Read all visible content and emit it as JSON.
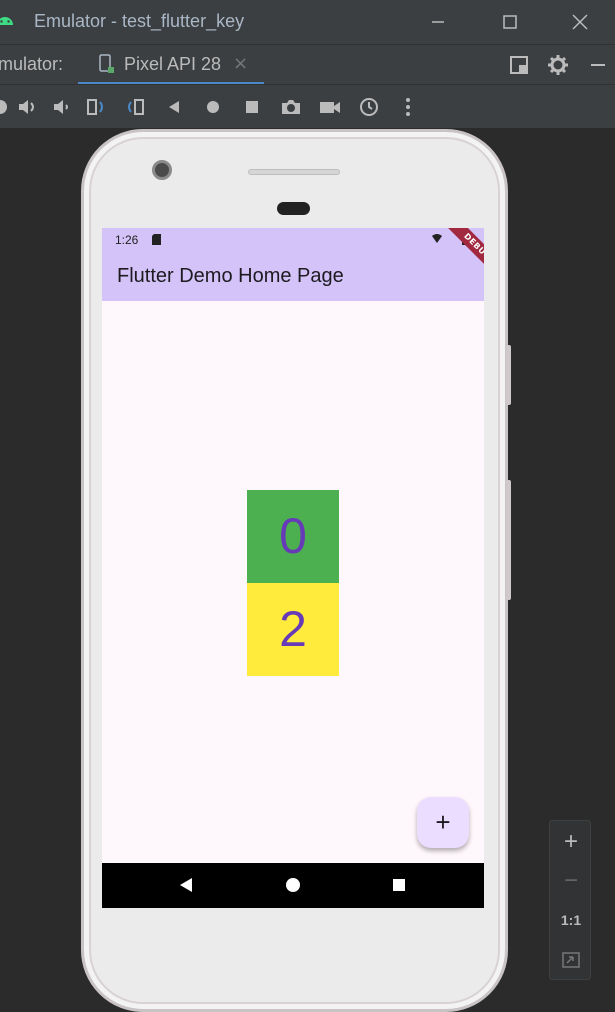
{
  "window": {
    "title": "Emulator - test_flutter_key",
    "minimize_icon": "minimize-icon",
    "maximize_icon": "maximize-icon",
    "close_icon": "close-icon"
  },
  "tabbar": {
    "label": "mulator:",
    "tab_label": "Pixel API 28",
    "tab_close": "×"
  },
  "toolbar": {
    "icons": [
      "power-icon",
      "volume-up-icon",
      "volume-down-icon",
      "rotate-left-icon",
      "rotate-right-icon",
      "back-icon",
      "home-icon",
      "overview-icon",
      "screenshot-icon",
      "record-icon",
      "snapshot-icon",
      "more-icon"
    ]
  },
  "device": {
    "status_time": "1:26",
    "appbar_title": "Flutter Demo Home Page",
    "debug_banner": "DEBUG",
    "box_top_value": "0",
    "box_bottom_value": "2",
    "fab_label": "+",
    "colors": {
      "appbar": "#d3c3f9",
      "box_top": "#4caf50",
      "box_bottom": "#ffeb3b",
      "number": "#673ab7",
      "fab": "#ebddff"
    }
  },
  "zoom": {
    "zoom_in": "+",
    "zoom_out": "−",
    "actual_size": "1:1"
  }
}
